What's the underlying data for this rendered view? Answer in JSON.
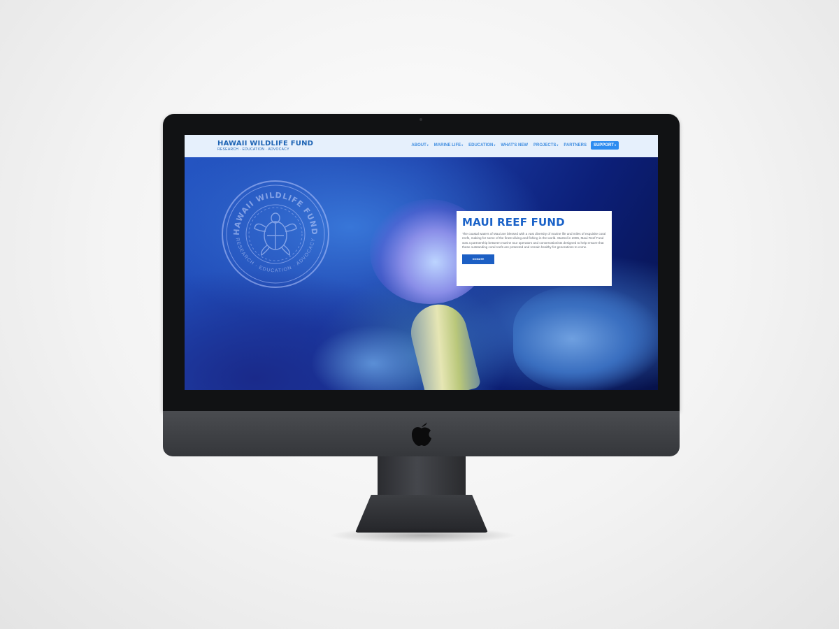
{
  "header": {
    "logo_title": "HAWAII  WILDLIFE  FUND",
    "logo_tagline": "RESEARCH · EDUCATION · ADVOCACY"
  },
  "nav": {
    "items": [
      {
        "label": "ABOUT",
        "dropdown": true
      },
      {
        "label": "MARINE LIFE",
        "dropdown": true
      },
      {
        "label": "EDUCATION",
        "dropdown": true
      },
      {
        "label": "WHAT'S NEW",
        "dropdown": false
      },
      {
        "label": "PROJECTS",
        "dropdown": true
      },
      {
        "label": "PARTNERS",
        "dropdown": false
      }
    ],
    "support_label": "SUPPORT",
    "caret": "▾"
  },
  "hero": {
    "seal_top_text": "HAWAII WILDLIFE FUND",
    "seal_bottom_text": "RESEARCH · EDUCATION · ADVOCACY",
    "card": {
      "title": "MAUI REEF FUND",
      "body": "The coastal waters of Maui are blessed with a vast diversity of marine life and miles of exquisite coral reefs, making for some of the finest diving and fishing in the world. Started in 2005, Maui Reef Fund was a partnership between marine tour operators and conservationists designed to help ensure that these outstanding coral reefs are protected and remain healthy for generations to come.",
      "button_label": "DONATE"
    }
  },
  "colors": {
    "accent": "#1c5fc4",
    "nav_background": "#e6f0fc",
    "nav_link": "#3f8de0",
    "support_button": "#2d8cf0"
  },
  "icons": {
    "device_logo": "apple-icon",
    "seal_emblem": "sea-turtle-icon"
  }
}
